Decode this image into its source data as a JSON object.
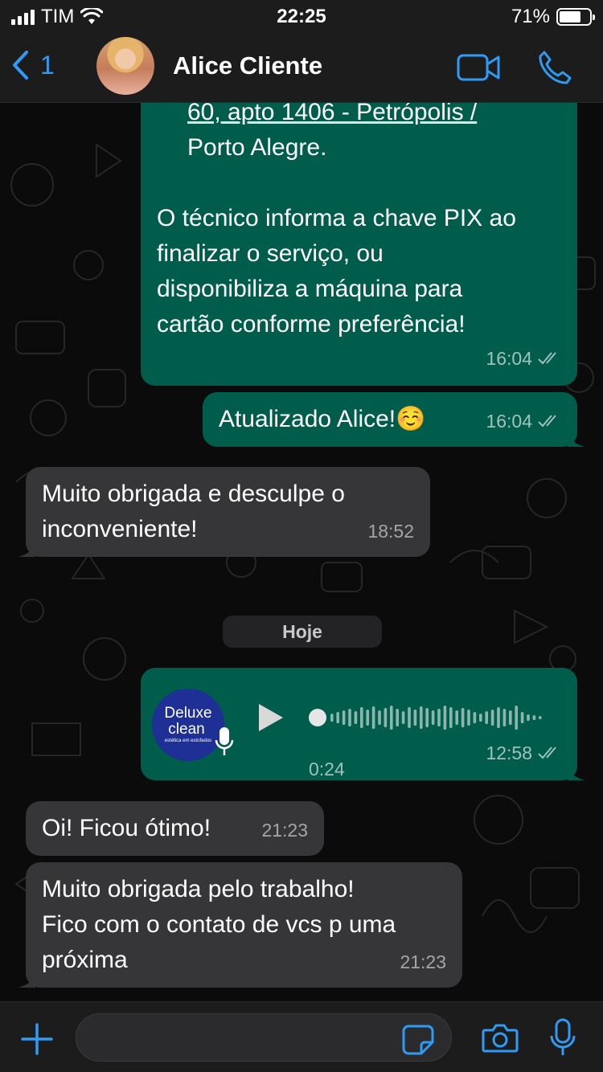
{
  "status_bar": {
    "carrier": "TIM",
    "time": "22:25",
    "battery_text": "71%",
    "battery_level": 0.71
  },
  "header": {
    "back_count": "1",
    "contact_name": "Alice  Cliente"
  },
  "messages": [
    {
      "direction": "outgoing",
      "lines": [
        "60, apto 1406 - Petrópolis /",
        "Porto Alegre.",
        "",
        "O técnico informa a chave PIX ao",
        "finalizar o serviço, ou",
        "disponibiliza a máquina para",
        "cartão conforme preferência!"
      ],
      "time": "16:04",
      "status": "read"
    },
    {
      "direction": "outgoing",
      "text": "Atualizado Alice!☺️",
      "time": "16:04",
      "status": "read"
    },
    {
      "direction": "incoming",
      "lines": [
        "Muito obrigada e desculpe o",
        "inconveniente!"
      ],
      "time": "18:52"
    },
    {
      "direction": "outgoing",
      "type": "voice",
      "avatar_brand": [
        "Deluxe",
        "clean",
        "estética em estofados"
      ],
      "duration": "0:24",
      "time": "12:58",
      "status": "read"
    },
    {
      "direction": "incoming",
      "text": "Oi! Ficou ótimo!",
      "time": "21:23"
    },
    {
      "direction": "incoming",
      "lines": [
        "Muito obrigada pelo trabalho!",
        "Fico com o contato de vcs p uma",
        "próxima"
      ],
      "time": "21:23"
    }
  ],
  "day_divider": "Hoje",
  "input": {
    "placeholder": ""
  },
  "colors": {
    "accent": "#2f9bf5",
    "outgoing_bubble": "#005c4b",
    "incoming_bubble": "#363638",
    "bar_background": "#1c1c1d"
  },
  "icons": {
    "back": "chevron-left-icon",
    "video": "video-camera-icon",
    "call": "phone-icon",
    "add": "plus-icon",
    "sticker": "sticker-icon",
    "camera": "camera-icon",
    "mic": "microphone-icon",
    "play": "play-icon"
  }
}
